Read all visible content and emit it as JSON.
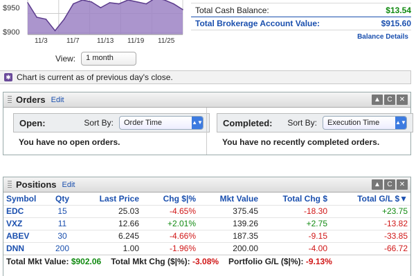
{
  "chart": {
    "y_ticks": [
      "$950",
      "$900"
    ],
    "x_ticks": [
      "11/3",
      "11/7",
      "11/13",
      "11/19",
      "11/25"
    ],
    "view_label": "View:",
    "view_value": "1 month",
    "line_color": "#5b3b8c",
    "fill_color": "#9c82c4"
  },
  "chart_data": {
    "type": "area",
    "x": [
      "11/3",
      "11/4",
      "11/5",
      "11/6",
      "11/7",
      "11/10",
      "11/11",
      "11/12",
      "11/13",
      "11/14",
      "11/17",
      "11/18",
      "11/19",
      "11/20",
      "11/21",
      "11/24",
      "11/25",
      "11/26"
    ],
    "values": [
      978,
      940,
      935,
      905,
      935,
      975,
      985,
      980,
      965,
      978,
      975,
      985,
      980,
      975,
      990,
      985,
      975,
      960
    ],
    "title": "",
    "xlabel": "",
    "ylabel": "",
    "ylim": [
      895,
      985
    ],
    "y_ticks": [
      950,
      900
    ],
    "grid": true
  },
  "balance": {
    "cash_label": "Total Cash Balance:",
    "cash_value": "$13.54",
    "account_label": "Total Brokerage Account Value:",
    "account_value": "$915.60",
    "details_link": "Balance Details"
  },
  "notice": {
    "text": "Chart is current as of previous day's close."
  },
  "orders": {
    "title": "Orders",
    "edit": "Edit",
    "open_label": "Open:",
    "sort_by": "Sort By:",
    "open_sort": "Order Time",
    "open_msg": "You have no open orders.",
    "completed_label": "Completed:",
    "completed_sort": "Execution Time",
    "completed_msg": "You have no recently completed orders."
  },
  "positions": {
    "title": "Positions",
    "edit": "Edit",
    "columns": [
      "Symbol",
      "Qty",
      "Last Price",
      "Chg $|%",
      "Mkt Value",
      "Total Chg $",
      "Total G/L $▼"
    ],
    "rows": [
      {
        "symbol": "EDC",
        "qty": "15",
        "last": "25.03",
        "chg": "-4.65%",
        "mkt": "375.45",
        "total_chg": "-18.30",
        "gl": "+23.75"
      },
      {
        "symbol": "VXZ",
        "qty": "11",
        "last": "12.66",
        "chg": "+2.01%",
        "mkt": "139.26",
        "total_chg": "+2.75",
        "gl": "-13.82"
      },
      {
        "symbol": "ABEV",
        "qty": "30",
        "last": "6.245",
        "chg": "-4.66%",
        "mkt": "187.35",
        "total_chg": "-9.15",
        "gl": "-33.85"
      },
      {
        "symbol": "DNN",
        "qty": "200",
        "last": "1.00",
        "chg": "-1.96%",
        "mkt": "200.00",
        "total_chg": "-4.00",
        "gl": "-66.72"
      }
    ],
    "total_mkt_label": "Total Mkt Value:",
    "total_mkt_value": "$902.06",
    "total_chg_label": "Total Mkt Chg ($|%):",
    "total_chg_value": "-3.08%",
    "portfolio_label": "Portfolio G/L ($|%):",
    "portfolio_value": "-9.13%"
  }
}
